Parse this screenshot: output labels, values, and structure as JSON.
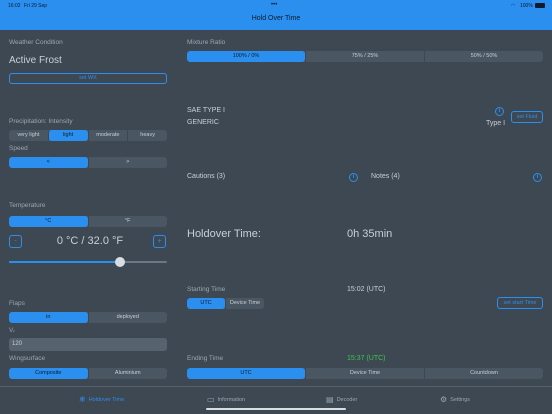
{
  "status": {
    "time": "16:02",
    "date": "Fri 29 Sep",
    "battery": "100%"
  },
  "nav": {
    "title": "Hold Over Time"
  },
  "left": {
    "weather_label": "Weather Condition",
    "weather_value": "Active Frost",
    "set_wx": "set WX",
    "precip_label": "Precipitation: Intensity",
    "precip_options": [
      "very light",
      "light",
      "moderate",
      "heavy"
    ],
    "speed_label": "Speed",
    "speed_options": [
      "<",
      ">"
    ],
    "temp_label": "Temperature",
    "temp_units": [
      "°C",
      "°F"
    ],
    "temp_value": "0 °C / 32.0 °F",
    "minus": "-",
    "plus": "+",
    "slider_fraction": 0.7,
    "flaps_label": "Flaps",
    "flaps_options": [
      "in",
      "deployed"
    ],
    "vr_label": "Vᵣ",
    "vr_value": "120",
    "wing_label": "Wingsurface",
    "wing_options": [
      "Composite",
      "Aluminium"
    ]
  },
  "right": {
    "mixture_label": "Mixture Ratio",
    "mixture_options": [
      "100% / 0%",
      "75% / 25%",
      "50% / 50%"
    ],
    "fluid_line1": "SAE TYPE I",
    "fluid_line2": "GENERIC",
    "fluid_type": "Type I",
    "set_fluid": "set Fluid",
    "cautions": "Cautions (3)",
    "notes": "Notes (4)",
    "holdover_label": "Holdover Time:",
    "holdover_value": "0h 35min",
    "start_label": "Starting Time",
    "start_value": "15:02 (UTC)",
    "start_options": [
      "UTC",
      "Device Time"
    ],
    "set_start": "set start Time",
    "end_label": "Ending Time",
    "end_value": "15:37 (UTC)",
    "end_options": [
      "UTC",
      "Device Time",
      "Countdown"
    ]
  },
  "tabs": [
    {
      "label": "Holdover Time",
      "icon": "snowflake-icon"
    },
    {
      "label": "Information",
      "icon": "monitor-icon"
    },
    {
      "label": "Decoder",
      "icon": "document-icon"
    },
    {
      "label": "Settings",
      "icon": "gear-icon"
    }
  ],
  "colors": {
    "accent": "#2b8ff0",
    "background": "#3d4852",
    "green": "#37c84a"
  }
}
